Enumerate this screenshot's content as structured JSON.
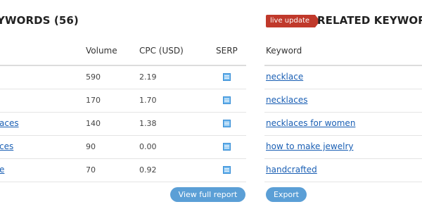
{
  "left_panel": {
    "title": "YWORDS (56)",
    "columns": {
      "volume": "Volume",
      "cpc": "CPC (USD)",
      "serp": "SERP"
    },
    "rows": [
      {
        "keyword": "",
        "volume": "590",
        "cpc": "2.19"
      },
      {
        "keyword": "",
        "volume": "170",
        "cpc": "1.70"
      },
      {
        "keyword": "aces",
        "volume": "140",
        "cpc": "1.38"
      },
      {
        "keyword": "ces",
        "volume": "90",
        "cpc": "0.00"
      },
      {
        "keyword": "e",
        "volume": "70",
        "cpc": "0.92"
      }
    ],
    "view_report_label": "View full report"
  },
  "right_panel": {
    "badge": "live update",
    "title": "RELATED KEYWORD",
    "columns": {
      "keyword": "Keyword"
    },
    "rows": [
      {
        "keyword": "necklace"
      },
      {
        "keyword": "necklaces"
      },
      {
        "keyword": "necklaces for women"
      },
      {
        "keyword": "how to make jewelry"
      },
      {
        "keyword": "handcrafted"
      }
    ],
    "export_label": "Export"
  },
  "colors": {
    "link": "#1a5fb4",
    "badge": "#c0392b",
    "button": "#5b9fd6",
    "serp_icon": "#6fb7ee"
  },
  "icons": {
    "serp": "serp-document-icon"
  }
}
